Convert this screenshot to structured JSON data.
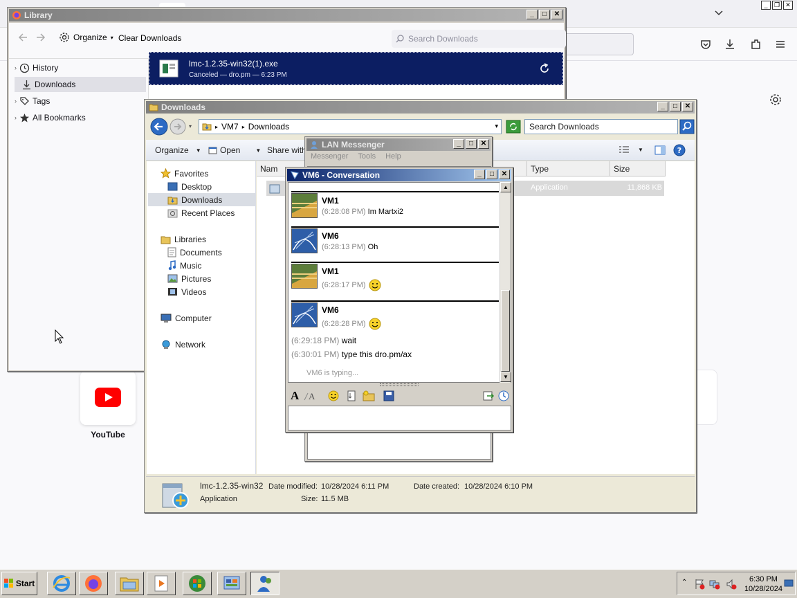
{
  "firefox": {
    "youtube_label": "YouTube"
  },
  "library": {
    "title": "Library",
    "organize_label": "Organize",
    "clear_label": "Clear Downloads",
    "search_placeholder": "Search Downloads",
    "sidebar": [
      {
        "label": "History",
        "icon": "clock-icon"
      },
      {
        "label": "Downloads",
        "icon": "download-icon"
      },
      {
        "label": "Tags",
        "icon": "tag-icon"
      },
      {
        "label": "All Bookmarks",
        "icon": "star-icon"
      }
    ],
    "download": {
      "filename": "lmc-1.2.35-win32(1).exe",
      "status": "Canceled — dro.pm — 6:23 PM"
    }
  },
  "explorer": {
    "title": "Downloads",
    "path": [
      "VM7",
      "Downloads"
    ],
    "search_placeholder": "Search Downloads",
    "commands": {
      "organize": "Organize",
      "open": "Open",
      "share": "Share with"
    },
    "nav": {
      "favorites": "Favorites",
      "desktop": "Desktop",
      "downloads": "Downloads",
      "recent": "Recent Places",
      "libraries": "Libraries",
      "documents": "Documents",
      "music": "Music",
      "pictures": "Pictures",
      "videos": "Videos",
      "computer": "Computer",
      "network": "Network"
    },
    "columns": {
      "name": "Nam",
      "type": "Type",
      "size": "Size"
    },
    "file": {
      "type": "Application",
      "size": "11,868 KB"
    },
    "details": {
      "name": "lmc-1.2.35-win32",
      "kind": "Application",
      "modified_label": "Date modified:",
      "modified": "10/28/2024 6:11 PM",
      "created_label": "Date created:",
      "created": "10/28/2024 6:10 PM",
      "size_label": "Size:",
      "size": "11.5 MB"
    }
  },
  "lan_messenger": {
    "title": "LAN Messenger",
    "menu": [
      "Messenger",
      "Tools",
      "Help"
    ]
  },
  "conversation": {
    "title": "VM6 - Conversation",
    "messages": [
      {
        "sender": "VM1",
        "time": "(6:28:08 PM)",
        "text": "Im Martxi2"
      },
      {
        "sender": "VM6",
        "time": "(6:28:13 PM)",
        "text": "Oh"
      },
      {
        "sender": "VM1",
        "time": "(6:28:17 PM)",
        "text": ""
      },
      {
        "sender": "VM6",
        "time": "(6:28:28 PM)",
        "text": ""
      }
    ],
    "followups": [
      {
        "time": "(6:29:18 PM)",
        "text": "wait"
      },
      {
        "time": "(6:30:01 PM)",
        "text": "type this dro.pm/ax"
      }
    ],
    "typing": "VM6 is typing..."
  },
  "taskbar": {
    "start_label": "Start",
    "time": "6:30 PM",
    "date": "10/28/2024"
  },
  "colors": {
    "active_title": "#0a246a",
    "download_row": "#0c1e62",
    "youtube_red": "#ff0000"
  }
}
